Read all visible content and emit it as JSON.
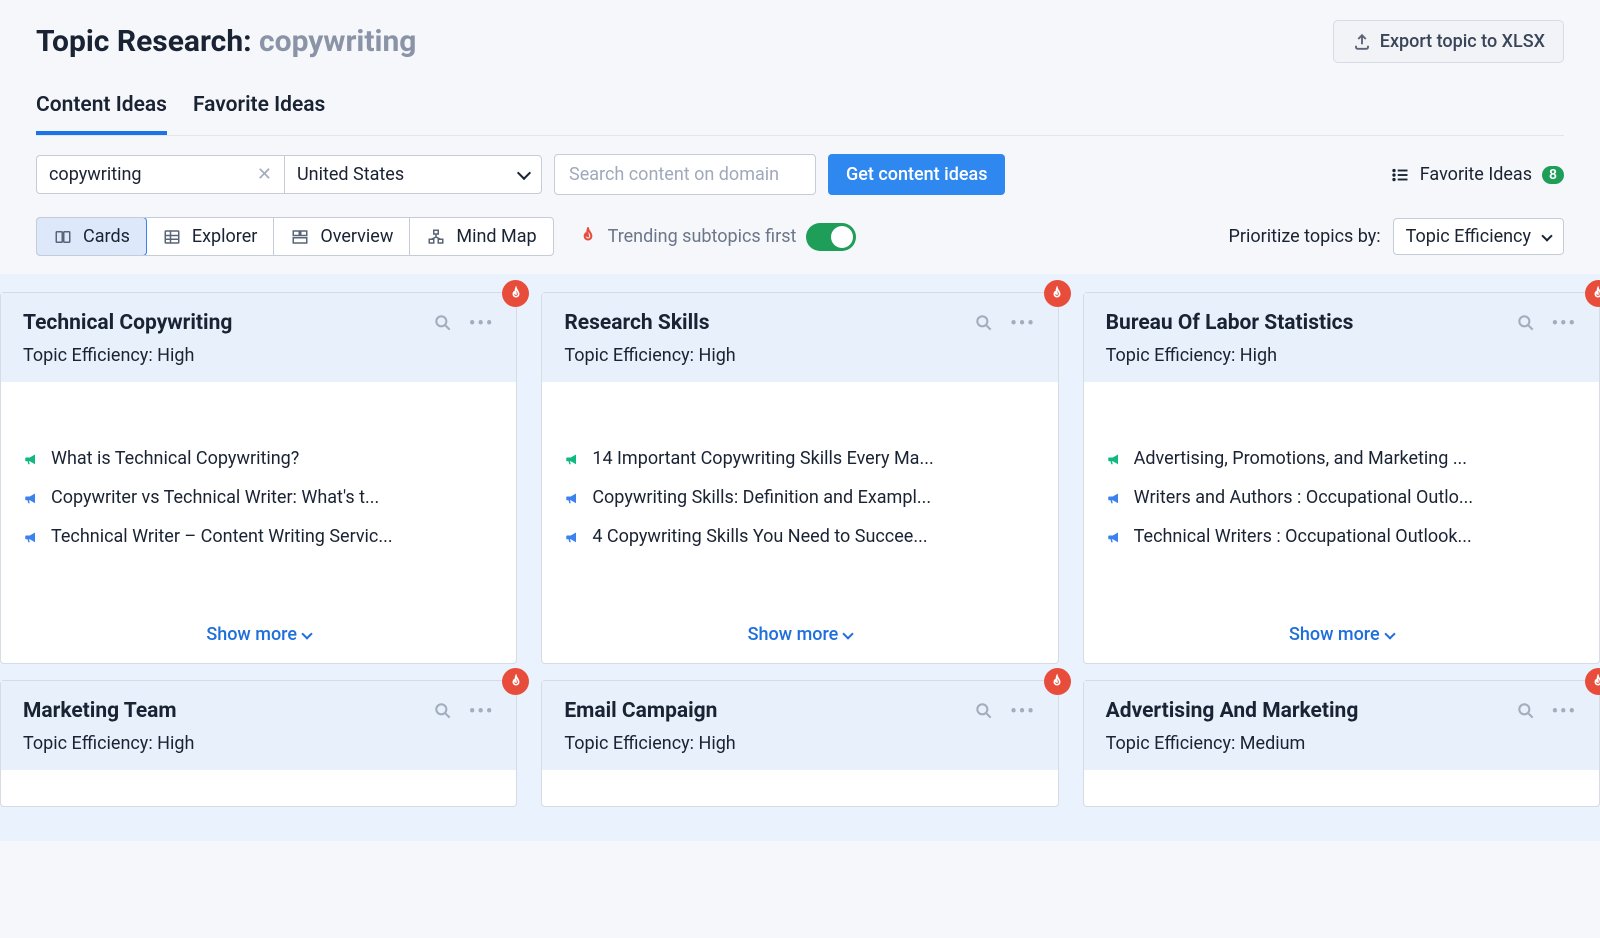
{
  "header": {
    "title_prefix": "Topic Research: ",
    "title_topic": "copywriting",
    "export_label": "Export topic to XLSX"
  },
  "tabs": [
    {
      "label": "Content Ideas",
      "active": true
    },
    {
      "label": "Favorite Ideas",
      "active": false
    }
  ],
  "filters": {
    "topic_value": "copywriting",
    "country_value": "United States",
    "domain_search_placeholder": "Search content on domain",
    "get_ideas_label": "Get content ideas",
    "favorite_ideas_label": "Favorite Ideas",
    "favorite_count": "8"
  },
  "views": {
    "options": [
      "Cards",
      "Explorer",
      "Overview",
      "Mind Map"
    ],
    "active": "Cards",
    "trending_label": "Trending subtopics first",
    "trending_on": true,
    "prioritize_label": "Prioritize topics by:",
    "prioritize_value": "Topic Efficiency"
  },
  "efficiency_label_prefix": "Topic Efficiency: ",
  "show_more_label": "Show more",
  "cards": [
    {
      "title": "Technical Copywriting",
      "efficiency": "High",
      "trending": true,
      "items": [
        {
          "color": "green",
          "text": "What is Technical Copywriting?"
        },
        {
          "color": "blue",
          "text": "Copywriter vs Technical Writer: What's t..."
        },
        {
          "color": "blue",
          "text": "Technical Writer – Content Writing Servic..."
        }
      ]
    },
    {
      "title": "Research Skills",
      "efficiency": "High",
      "trending": true,
      "items": [
        {
          "color": "green",
          "text": "14 Important Copywriting Skills Every Ma..."
        },
        {
          "color": "blue",
          "text": "Copywriting Skills: Definition and Exampl..."
        },
        {
          "color": "blue",
          "text": "4 Copywriting Skills You Need to Succee..."
        }
      ]
    },
    {
      "title": "Bureau Of Labor Statistics",
      "efficiency": "High",
      "trending": true,
      "items": [
        {
          "color": "green",
          "text": "Advertising, Promotions, and Marketing ..."
        },
        {
          "color": "blue",
          "text": "Writers and Authors : Occupational Outlo..."
        },
        {
          "color": "blue",
          "text": "Technical Writers : Occupational Outlook..."
        }
      ]
    },
    {
      "title": "Marketing Team",
      "efficiency": "High",
      "trending": true,
      "items": []
    },
    {
      "title": "Email Campaign",
      "efficiency": "High",
      "trending": true,
      "items": []
    },
    {
      "title": "Advertising And Marketing",
      "efficiency": "Medium",
      "trending": true,
      "items": []
    }
  ]
}
